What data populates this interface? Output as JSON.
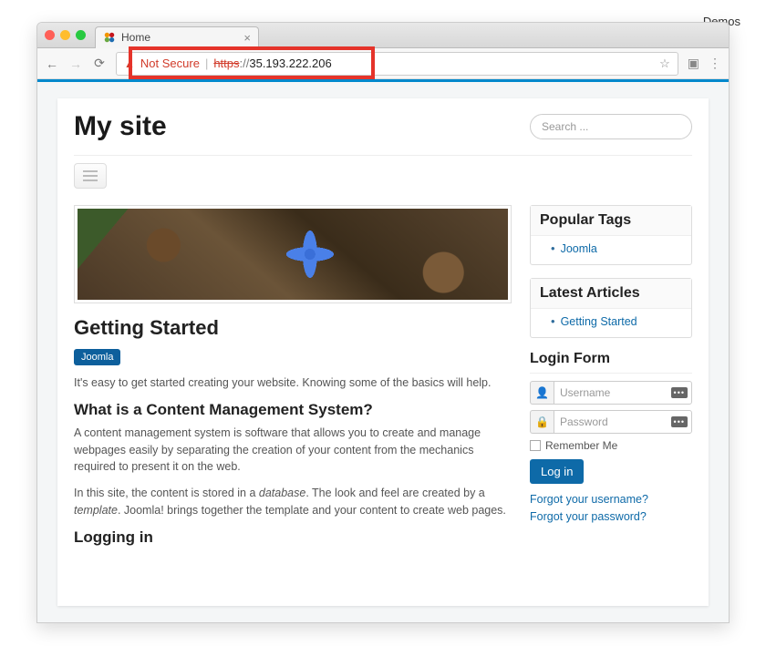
{
  "outer": {
    "demos_label": "Demos"
  },
  "browser": {
    "tab_title": "Home",
    "not_secure_label": "Not Secure",
    "url_scheme": "https",
    "url_sep": "://",
    "url_host": "35.193.222.206"
  },
  "header": {
    "site_title": "My site",
    "search_placeholder": "Search ..."
  },
  "article": {
    "title": "Getting Started",
    "tag": "Joomla",
    "intro": "It's easy to get started creating your website. Knowing some of the basics will help.",
    "h1": "What is a Content Management System?",
    "p1": "A content management system is software that allows you to create and manage webpages easily by separating the creation of your content from the mechanics required to present it on the web.",
    "p2a": "In this site, the content is stored in a ",
    "p2_db": "database",
    "p2b": ". The look and feel are created by a ",
    "p2_tpl": "template",
    "p2c": ". Joomla! brings together the template and your content to create web pages.",
    "h2": "Logging in"
  },
  "sidebar": {
    "popular_tags_title": "Popular Tags",
    "popular_tags": [
      {
        "label": "Joomla"
      }
    ],
    "latest_title": "Latest Articles",
    "latest": [
      {
        "label": "Getting Started"
      }
    ],
    "login_title": "Login Form",
    "username_placeholder": "Username",
    "password_placeholder": "Password",
    "remember_label": "Remember Me",
    "login_button": "Log in",
    "forgot_username": "Forgot your username?",
    "forgot_password": "Forgot your password?"
  }
}
